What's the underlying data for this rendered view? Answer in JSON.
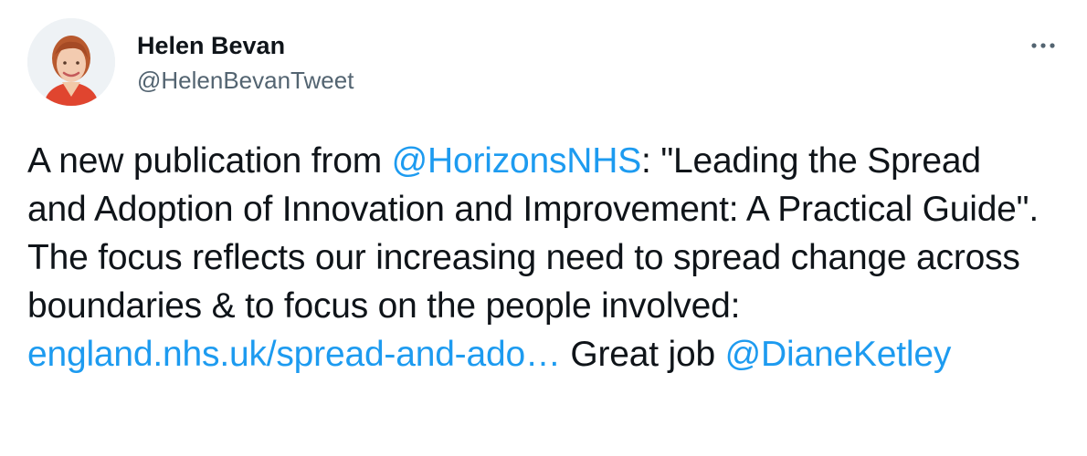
{
  "author": {
    "display_name": "Helen Bevan",
    "handle": "@HelenBevanTweet"
  },
  "more_icon": "more-horizontal-icon",
  "colors": {
    "text": "#0f1419",
    "secondary": "#536471",
    "link": "#1d9bf0"
  },
  "tweet": {
    "text_1": "A new publication from ",
    "mention_1": "@HorizonsNHS",
    "text_2": ": \"Leading the Spread and Adoption of Innovation and Improvement: A Practical Guide\". The focus reflects our increasing need to spread change across boundaries & to focus on the people involved: ",
    "url": "england.nhs.uk/spread-and-ado…",
    "text_3": " Great job ",
    "mention_2": "@DianeKetley"
  }
}
